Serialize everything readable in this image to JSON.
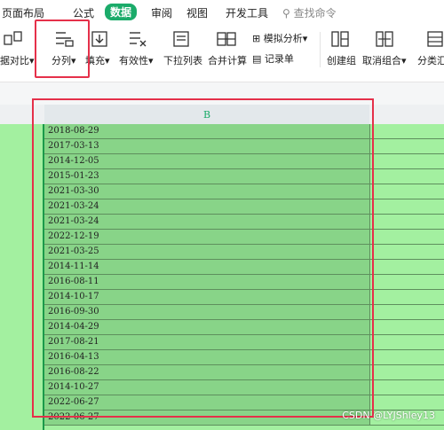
{
  "menu": {
    "items": [
      "页面布局",
      "公式",
      "数据",
      "审阅",
      "视图",
      "开发工具"
    ],
    "active": "数据",
    "search_placeholder": "查找命令"
  },
  "toolbar": {
    "compare": "据对比",
    "split_columns": "分列",
    "fill": "填充",
    "validity": "有效性",
    "dropdown_list": "下拉列表",
    "consolidate": "合并计算",
    "what_if": "模拟分析",
    "record_sheet": "记录单",
    "group": "创建组",
    "ungroup": "取消组合",
    "subtotal": "分类汇"
  },
  "sheet": {
    "column_header": "B",
    "rows": [
      "2018-08-29",
      "2017-03-13",
      "2014-12-05",
      "2015-01-23",
      "2021-03-30",
      "2021-03-24",
      "2021-03-24",
      "2022-12-19",
      "2021-03-25",
      "2014-11-14",
      "2016-08-11",
      "2014-10-17",
      "2016-09-30",
      "2014-04-29",
      "2017-08-21",
      "2016-04-13",
      "2016-08-22",
      "2014-10-27",
      "2022-06-27",
      "2022-06-27"
    ]
  },
  "colors": {
    "accent": "#1bab6a",
    "highlight": "#e5304a",
    "selection_fill": "#88d488"
  },
  "watermark": "CSDN @LYJShley13"
}
